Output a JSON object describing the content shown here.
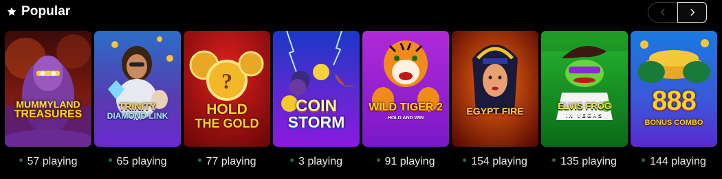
{
  "section": {
    "title": "Popular",
    "icon": "star-icon"
  },
  "nav": {
    "prev_icon": "chevron-left-icon",
    "next_icon": "chevron-right-icon"
  },
  "games": [
    {
      "logo_line1": "MUMMYLAND",
      "logo_line2": "TREASURES",
      "players": "57 playing"
    },
    {
      "logo_line1": "TRINITY",
      "logo_line2": "DIAMOND LINK",
      "players": "65 playing"
    },
    {
      "logo_line1": "HOLD",
      "logo_line2": "THE GOLD",
      "players": "77 playing"
    },
    {
      "logo_line1": "COIN",
      "logo_line2": "STORM",
      "players": "3 playing"
    },
    {
      "logo_line1": "WILD TIGER 2",
      "logo_line2": "HOLD AND WIN",
      "players": "91 playing"
    },
    {
      "logo_line1": "EGYPT FIRE",
      "logo_line2": "",
      "players": "154 playing"
    },
    {
      "logo_line1": "ELVIS FROG",
      "logo_line2": "IN VEGAS",
      "players": "135 playing"
    },
    {
      "logo_line1": "888",
      "logo_line2": "BONUS COMBO",
      "players": "144 playing"
    }
  ],
  "colors": {
    "accent_green_dot": "#2e6b3f",
    "background": "#000000"
  }
}
